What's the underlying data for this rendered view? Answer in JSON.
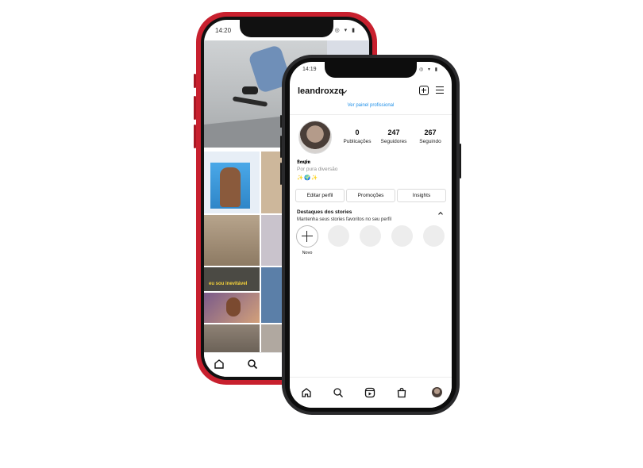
{
  "back_phone": {
    "status": {
      "time": "14:20",
      "right_icons": "◎ ▾ ▮"
    },
    "feed_caption": "eu sou inevitável"
  },
  "front_phone": {
    "status": {
      "time": "14:19",
      "right_icons": "◎ ▾ ▮"
    },
    "profile": {
      "username": "leandroxzq",
      "pro_dashboard_link": "Ver painel profissional",
      "stats": [
        {
          "value": "0",
          "label": "Publicações"
        },
        {
          "value": "247",
          "label": "Seguidores"
        },
        {
          "value": "267",
          "label": "Seguindo"
        }
      ],
      "bio_name": "𝕷𝖊𝖔𝖟𝖎𝖓",
      "bio_category": "Por pura diversão",
      "bio_emojis": "✨🌍✨",
      "buttons": {
        "edit_profile": "Editar perfil",
        "promotions": "Promoções",
        "insights": "Insights"
      },
      "highlights": {
        "title": "Destaques dos stories",
        "subtitle": "Mantenha seus stories favoritos no seu perfil",
        "new_label": "Novo"
      }
    }
  }
}
